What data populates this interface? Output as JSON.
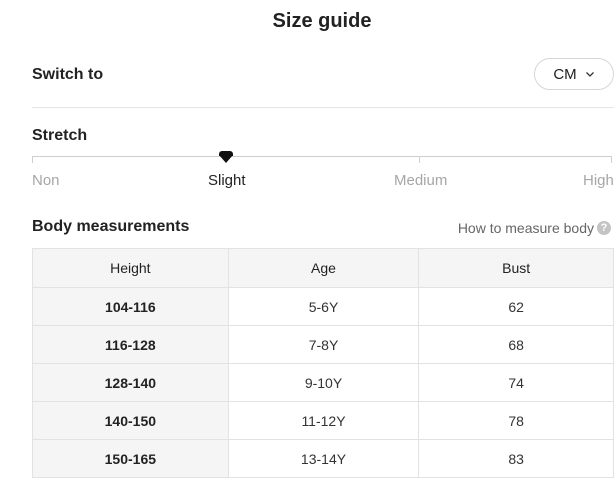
{
  "title": "Size guide",
  "switch": {
    "label": "Switch to",
    "unit": "CM"
  },
  "stretch": {
    "label": "Stretch",
    "options": [
      "Non",
      "Slight",
      "Medium",
      "High"
    ],
    "selected": "Slight"
  },
  "body_measurements": {
    "label": "Body measurements",
    "help_link": "How to measure body",
    "columns": [
      "Height",
      "Age",
      "Bust"
    ],
    "rows": [
      [
        "104-116",
        "5-6Y",
        "62"
      ],
      [
        "116-128",
        "7-8Y",
        "68"
      ],
      [
        "128-140",
        "9-10Y",
        "74"
      ],
      [
        "140-150",
        "11-12Y",
        "78"
      ],
      [
        "150-165",
        "13-14Y",
        "83"
      ]
    ]
  }
}
